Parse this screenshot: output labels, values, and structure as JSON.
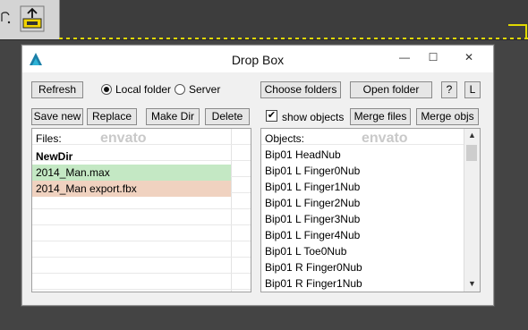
{
  "dialog": {
    "title": "Drop Box",
    "controls": {
      "minimize": "—",
      "maximize": "☐",
      "close": "✕"
    }
  },
  "toolbar_row1": {
    "refresh": "Refresh",
    "local_folder": "Local folder",
    "server": "Server",
    "source_selected": "Local folder",
    "choose_folders": "Choose folders",
    "open_folder": "Open folder",
    "help": "?",
    "l_button": "L"
  },
  "toolbar_row2": {
    "save_new": "Save new",
    "replace": "Replace",
    "make_dir": "Make Dir",
    "delete": "Delete",
    "show_objects": "show objects",
    "show_objects_checked": true,
    "merge_files": "Merge files",
    "merge_objs": "Merge objs"
  },
  "files": {
    "header": "Files:",
    "items": [
      {
        "label": "NewDir",
        "bold": true,
        "highlight": ""
      },
      {
        "label": "2014_Man.max",
        "bold": false,
        "highlight": "#c4e8c4"
      },
      {
        "label": "2014_Man export.fbx",
        "bold": false,
        "highlight": "#f0d2c0"
      }
    ]
  },
  "objects": {
    "header": "Objects:",
    "items": [
      "Bip01 HeadNub",
      "Bip01 L Finger0Nub",
      "Bip01 L Finger1Nub",
      "Bip01 L Finger2Nub",
      "Bip01 L Finger3Nub",
      "Bip01 L Finger4Nub",
      "Bip01 L Toe0Nub",
      "Bip01 R Finger0Nub",
      "Bip01 R Finger1Nub"
    ]
  },
  "watermark": "envato",
  "colors": {
    "dialog_bg": "#f0f0f0",
    "max_file_highlight": "#c4e8c4",
    "fbx_file_highlight": "#f0d2c0",
    "accent_dash": "#e0d800"
  }
}
